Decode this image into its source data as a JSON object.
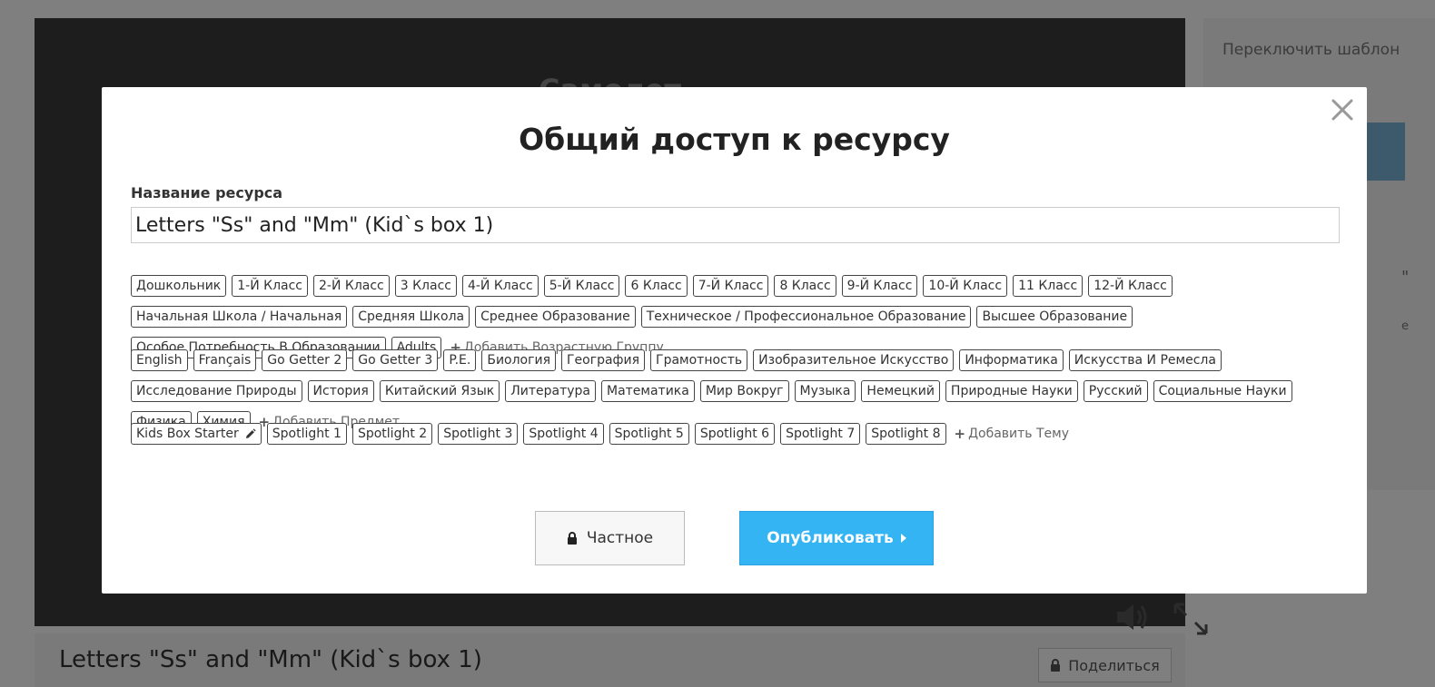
{
  "background": {
    "stage_title": "Самолет",
    "sidebar_title": "Переключить шаблон",
    "sidebar_quote": "\"",
    "sidebar_char": "e",
    "resource_title": "Letters \"Ss\" and \"Mm\" (Kid`s box 1)",
    "share_label": "Поделиться"
  },
  "modal": {
    "title": "Общий доступ к ресурсу",
    "name_label": "Название ресурса",
    "name_value": "Letters \"Ss\" and \"Mm\" (Kid`s box 1)",
    "age_groups": [
      "Дошкольник",
      "1-Й Класс",
      "2-Й Класс",
      "3 Класс",
      "4-Й Класс",
      "5-Й Класс",
      "6 Класс",
      "7-Й Класс",
      "8 Класс",
      "9-Й Класс",
      "10-Й Класс",
      "11 Класс",
      "12-Й Класс",
      "Начальная Школа / Начальная",
      "Средняя Школа",
      "Среднее Образование",
      "Техническое / Профессиональное Образование",
      "Высшее Образование",
      "Особое Потребность В Образовании",
      "Adults"
    ],
    "add_age_group": "Добавить Возрастную Группу",
    "subjects": [
      "English",
      "Français",
      "Go Getter 2",
      "Go Getter 3",
      "P.E.",
      "Биология",
      "География",
      "Грамотность",
      "Изобразительное Искусство",
      "Информатика",
      "Искусства И Ремесла",
      "Исследование Природы",
      "История",
      "Китайский Язык",
      "Литература",
      "Математика",
      "Мир Вокруг",
      "Музыка",
      "Немецкий",
      "Природные Науки",
      "Русский",
      "Социальные Науки",
      "Физика",
      "Химия"
    ],
    "add_subject": "Добавить Предмет",
    "topics": [
      "Kids Box Starter",
      "Spotlight 1",
      "Spotlight 2",
      "Spotlight 3",
      "Spotlight 4",
      "Spotlight 5",
      "Spotlight 6",
      "Spotlight 7",
      "Spotlight 8"
    ],
    "add_topic": "Добавить Тему",
    "private_label": "Частное",
    "publish_label": "Опубликовать"
  },
  "icons": {
    "close": "close-icon",
    "pencil": "pencil-icon",
    "lock": "lock-icon",
    "caret": "caret-right-icon",
    "plus": "plus-icon",
    "audio": "audio-icon",
    "expand": "expand-icon"
  },
  "colors": {
    "publish": "#35b4f4",
    "backdrop": "#7a7a7a",
    "stage": "#3b3b3b",
    "tag_border": "#444444"
  }
}
